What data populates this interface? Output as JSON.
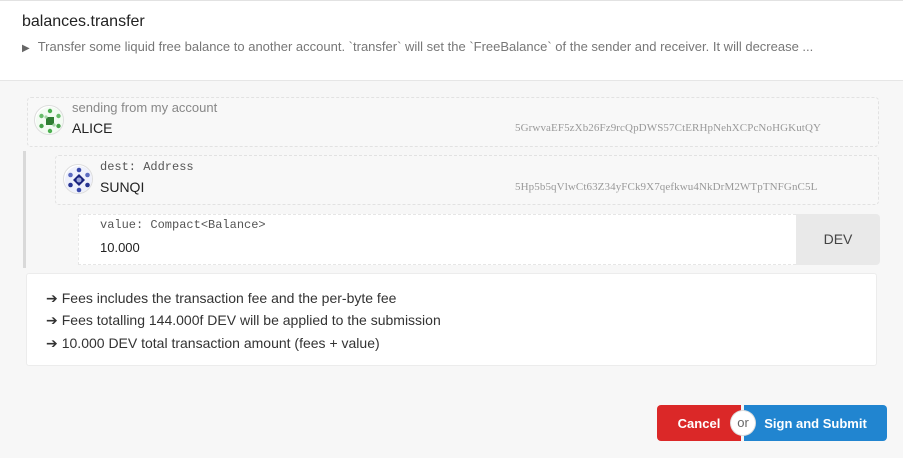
{
  "header": {
    "title": "balances.transfer",
    "description": "Transfer some liquid free balance to another account. `transfer` will set the `FreeBalance` of the sender and receiver. It will decrease ..."
  },
  "sender": {
    "label": "sending from my account",
    "name": "ALICE",
    "address": "5GrwvaEF5zXb26Fz9rcQpDWS57CtERHpNehXCPcNoHGKutQY"
  },
  "dest": {
    "label": "dest: Address",
    "name": "SUNQI",
    "address": "5Hp5b5qVlwCt63Z34yFCk9X7qefkwu4NkDrM2WTpTNFGnC5L"
  },
  "value": {
    "label": "value: Compact<Balance>",
    "input": "10.000",
    "unit": "DEV"
  },
  "fees": [
    "Fees includes the transaction fee and the per-byte fee",
    "Fees totalling 144.000f DEV will be applied to the submission",
    "10.000 DEV total transaction amount (fees + value)"
  ],
  "actions": {
    "cancel": "Cancel",
    "or": "or",
    "submit": "Sign and Submit"
  },
  "colors": {
    "cancel": "#db2828",
    "submit": "#2185d0"
  },
  "icons": {
    "expand": "triangle-right-icon",
    "fee_arrow": "arrow-right-icon"
  }
}
